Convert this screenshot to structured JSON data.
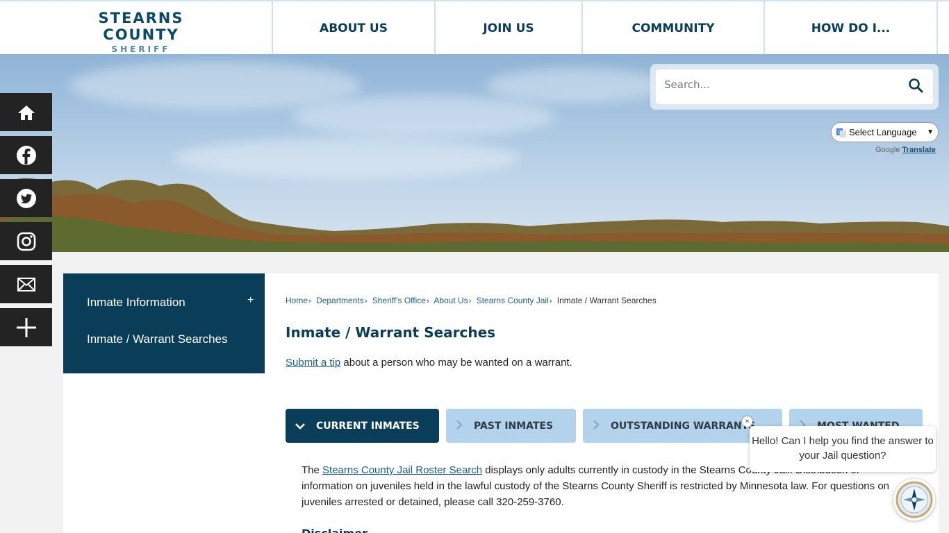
{
  "header": {
    "logo_main": "STEARNS COUNTY",
    "logo_sub": "SHERIFF",
    "nav": [
      "ABOUT US",
      "JOIN US",
      "COMMUNITY",
      "HOW DO I..."
    ]
  },
  "search": {
    "placeholder": "Search...",
    "icon": "magnifier-icon"
  },
  "translate": {
    "select_label": "Select Language",
    "powered_prefix": "Google",
    "powered_link": "Translate"
  },
  "social": [
    "home-icon",
    "facebook-icon",
    "twitter-icon",
    "instagram-icon",
    "email-icon",
    "plus-icon"
  ],
  "sidenav": {
    "items": [
      "Inmate Information",
      "Inmate / Warrant Searches"
    ],
    "expand": "+"
  },
  "breadcrumb": [
    "Home",
    "Departments",
    "Sheriff's Office",
    "About Us",
    "Stearns County Jail",
    "Inmate / Warrant Searches"
  ],
  "page_title": "Inmate / Warrant Searches",
  "intro": {
    "link": "Submit a tip",
    "text": " about a person who may be wanted on a warrant."
  },
  "tabs": [
    "CURRENT INMATES",
    "PAST INMATES",
    "OUTSTANDING WARRANTS",
    "MOST WANTED"
  ],
  "body": {
    "prefix": "The ",
    "link": "Stearns County Jail Roster Search",
    "rest": " displays only adults currently in custody in the Stearns County Jail. Distribution of information on juveniles held in the lawful custody of the Stearns County Sheriff is restricted by Minnesota law. For questions on juveniles arrested or detained, please call 320-259-3760."
  },
  "disclaimer": "Disclaimer",
  "chat": {
    "message": "Hello! Can I help you find the answer to your Jail question?",
    "close": "×"
  },
  "colors": {
    "primary": "#0a3d57",
    "tab_inactive": "#b3d3ec",
    "link": "#1a5f8a"
  }
}
